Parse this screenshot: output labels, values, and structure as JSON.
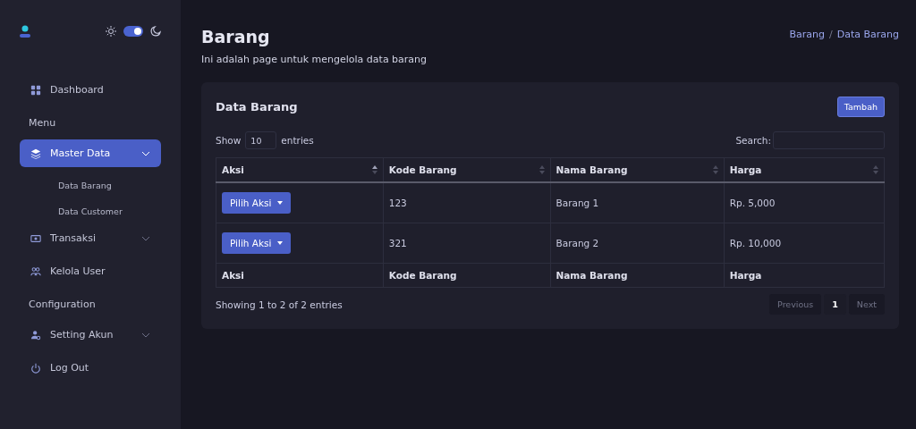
{
  "sidebar": {
    "theme_toggle": {
      "on": true
    },
    "items": [
      {
        "kind": "link",
        "label": "Dashboard"
      },
      {
        "kind": "section",
        "label": "Menu"
      },
      {
        "kind": "group",
        "label": "Master Data",
        "selected": true,
        "expanded": true,
        "children": [
          {
            "label": "Data Barang"
          },
          {
            "label": "Data Customer"
          }
        ]
      },
      {
        "kind": "group",
        "label": "Transaksi",
        "selected": false,
        "expanded": false
      },
      {
        "kind": "link",
        "label": "Kelola User"
      },
      {
        "kind": "section",
        "label": "Configuration"
      },
      {
        "kind": "group",
        "label": "Setting Akun",
        "selected": false,
        "expanded": false
      },
      {
        "kind": "link",
        "label": "Log Out"
      }
    ]
  },
  "page": {
    "title": "Barang",
    "subtitle": "Ini adalah page untuk mengelola data barang",
    "breadcrumb": [
      "Barang",
      "Data Barang"
    ],
    "breadcrumb_separator": "/"
  },
  "card": {
    "title": "Data Barang",
    "add_button": "Tambah",
    "length": {
      "before": "Show",
      "value": "10",
      "after": "entries"
    },
    "search": {
      "label": "Search:"
    },
    "table": {
      "columns": [
        {
          "label": "Aksi",
          "sorted": true
        },
        {
          "label": "Kode Barang",
          "sorted": false
        },
        {
          "label": "Nama Barang",
          "sorted": false
        },
        {
          "label": "Harga",
          "sorted": false
        }
      ],
      "rows": [
        {
          "action": "Pilih Aksi",
          "kode": "123",
          "nama": "Barang 1",
          "harga": "Rp. 5,000"
        },
        {
          "action": "Pilih Aksi",
          "kode": "321",
          "nama": "Barang 2",
          "harga": "Rp. 10,000"
        }
      ],
      "footer": [
        "Aksi",
        "Kode Barang",
        "Nama Barang",
        "Harga"
      ]
    },
    "info": "Showing 1 to 2 of 2 entries",
    "pagination": [
      {
        "label": "Previous",
        "selected": false,
        "disabled": true
      },
      {
        "label": "1",
        "selected": true,
        "disabled": false
      },
      {
        "label": "Next",
        "selected": false,
        "disabled": true
      }
    ]
  }
}
